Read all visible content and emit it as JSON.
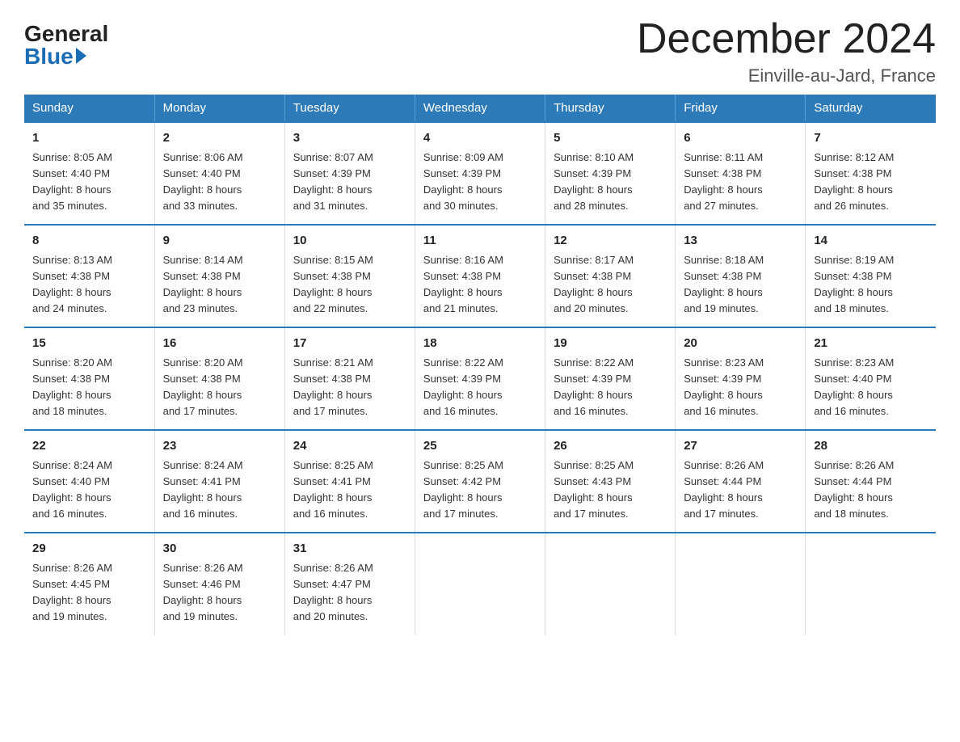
{
  "logo": {
    "general": "General",
    "blue": "Blue"
  },
  "title": "December 2024",
  "location": "Einville-au-Jard, France",
  "headers": [
    "Sunday",
    "Monday",
    "Tuesday",
    "Wednesday",
    "Thursday",
    "Friday",
    "Saturday"
  ],
  "weeks": [
    [
      {
        "day": "1",
        "info": "Sunrise: 8:05 AM\nSunset: 4:40 PM\nDaylight: 8 hours\nand 35 minutes."
      },
      {
        "day": "2",
        "info": "Sunrise: 8:06 AM\nSunset: 4:40 PM\nDaylight: 8 hours\nand 33 minutes."
      },
      {
        "day": "3",
        "info": "Sunrise: 8:07 AM\nSunset: 4:39 PM\nDaylight: 8 hours\nand 31 minutes."
      },
      {
        "day": "4",
        "info": "Sunrise: 8:09 AM\nSunset: 4:39 PM\nDaylight: 8 hours\nand 30 minutes."
      },
      {
        "day": "5",
        "info": "Sunrise: 8:10 AM\nSunset: 4:39 PM\nDaylight: 8 hours\nand 28 minutes."
      },
      {
        "day": "6",
        "info": "Sunrise: 8:11 AM\nSunset: 4:38 PM\nDaylight: 8 hours\nand 27 minutes."
      },
      {
        "day": "7",
        "info": "Sunrise: 8:12 AM\nSunset: 4:38 PM\nDaylight: 8 hours\nand 26 minutes."
      }
    ],
    [
      {
        "day": "8",
        "info": "Sunrise: 8:13 AM\nSunset: 4:38 PM\nDaylight: 8 hours\nand 24 minutes."
      },
      {
        "day": "9",
        "info": "Sunrise: 8:14 AM\nSunset: 4:38 PM\nDaylight: 8 hours\nand 23 minutes."
      },
      {
        "day": "10",
        "info": "Sunrise: 8:15 AM\nSunset: 4:38 PM\nDaylight: 8 hours\nand 22 minutes."
      },
      {
        "day": "11",
        "info": "Sunrise: 8:16 AM\nSunset: 4:38 PM\nDaylight: 8 hours\nand 21 minutes."
      },
      {
        "day": "12",
        "info": "Sunrise: 8:17 AM\nSunset: 4:38 PM\nDaylight: 8 hours\nand 20 minutes."
      },
      {
        "day": "13",
        "info": "Sunrise: 8:18 AM\nSunset: 4:38 PM\nDaylight: 8 hours\nand 19 minutes."
      },
      {
        "day": "14",
        "info": "Sunrise: 8:19 AM\nSunset: 4:38 PM\nDaylight: 8 hours\nand 18 minutes."
      }
    ],
    [
      {
        "day": "15",
        "info": "Sunrise: 8:20 AM\nSunset: 4:38 PM\nDaylight: 8 hours\nand 18 minutes."
      },
      {
        "day": "16",
        "info": "Sunrise: 8:20 AM\nSunset: 4:38 PM\nDaylight: 8 hours\nand 17 minutes."
      },
      {
        "day": "17",
        "info": "Sunrise: 8:21 AM\nSunset: 4:38 PM\nDaylight: 8 hours\nand 17 minutes."
      },
      {
        "day": "18",
        "info": "Sunrise: 8:22 AM\nSunset: 4:39 PM\nDaylight: 8 hours\nand 16 minutes."
      },
      {
        "day": "19",
        "info": "Sunrise: 8:22 AM\nSunset: 4:39 PM\nDaylight: 8 hours\nand 16 minutes."
      },
      {
        "day": "20",
        "info": "Sunrise: 8:23 AM\nSunset: 4:39 PM\nDaylight: 8 hours\nand 16 minutes."
      },
      {
        "day": "21",
        "info": "Sunrise: 8:23 AM\nSunset: 4:40 PM\nDaylight: 8 hours\nand 16 minutes."
      }
    ],
    [
      {
        "day": "22",
        "info": "Sunrise: 8:24 AM\nSunset: 4:40 PM\nDaylight: 8 hours\nand 16 minutes."
      },
      {
        "day": "23",
        "info": "Sunrise: 8:24 AM\nSunset: 4:41 PM\nDaylight: 8 hours\nand 16 minutes."
      },
      {
        "day": "24",
        "info": "Sunrise: 8:25 AM\nSunset: 4:41 PM\nDaylight: 8 hours\nand 16 minutes."
      },
      {
        "day": "25",
        "info": "Sunrise: 8:25 AM\nSunset: 4:42 PM\nDaylight: 8 hours\nand 17 minutes."
      },
      {
        "day": "26",
        "info": "Sunrise: 8:25 AM\nSunset: 4:43 PM\nDaylight: 8 hours\nand 17 minutes."
      },
      {
        "day": "27",
        "info": "Sunrise: 8:26 AM\nSunset: 4:44 PM\nDaylight: 8 hours\nand 17 minutes."
      },
      {
        "day": "28",
        "info": "Sunrise: 8:26 AM\nSunset: 4:44 PM\nDaylight: 8 hours\nand 18 minutes."
      }
    ],
    [
      {
        "day": "29",
        "info": "Sunrise: 8:26 AM\nSunset: 4:45 PM\nDaylight: 8 hours\nand 19 minutes."
      },
      {
        "day": "30",
        "info": "Sunrise: 8:26 AM\nSunset: 4:46 PM\nDaylight: 8 hours\nand 19 minutes."
      },
      {
        "day": "31",
        "info": "Sunrise: 8:26 AM\nSunset: 4:47 PM\nDaylight: 8 hours\nand 20 minutes."
      },
      {
        "day": "",
        "info": ""
      },
      {
        "day": "",
        "info": ""
      },
      {
        "day": "",
        "info": ""
      },
      {
        "day": "",
        "info": ""
      }
    ]
  ]
}
